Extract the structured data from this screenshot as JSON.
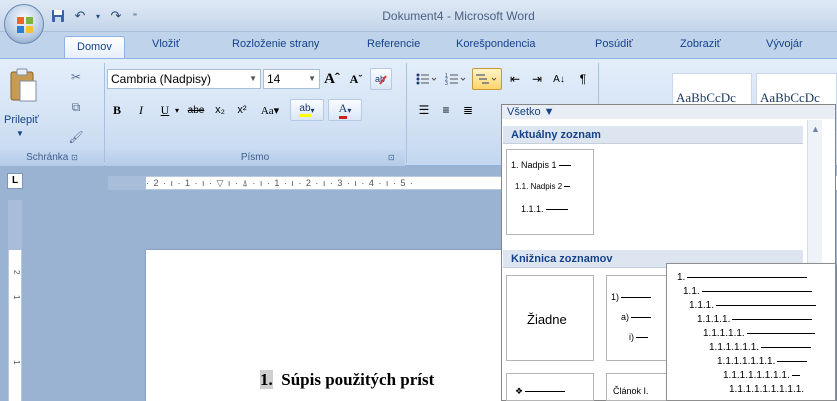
{
  "window": {
    "title_doc": "Dokument4",
    "title_app": "Microsoft Word",
    "separator": " - "
  },
  "tabs": [
    "Domov",
    "Vložiť",
    "Rozloženie strany",
    "Referencie",
    "Korešpondencia",
    "Posúdiť",
    "Zobraziť",
    "Vývojár"
  ],
  "clipboard": {
    "paste_label": "Prilepiť",
    "group_label": "Schránka"
  },
  "font": {
    "name": "Cambria (Nadpisy)",
    "size": "14",
    "group_label": "Písmo"
  },
  "styles": [
    "AaBbCcDc",
    "AaBbCcDc"
  ],
  "ruler": {
    "corner": "L",
    "text": "· 2 · ı · 1 · ı ·  ▽ ı · ⍋ · ı · 1 · ı · 2 · ı · 3 · ı · 4 · ı · 5 ·",
    "right_mark": "· 1",
    "vticks": [
      "2",
      "1",
      "1"
    ]
  },
  "document": {
    "heading_number": "1.",
    "heading_text": "Súpis použitých príst"
  },
  "list_panel": {
    "filter": "Všetko ▼",
    "current_section": "Aktuálny zoznam",
    "library_section": "Knižnica zoznamov",
    "current_lines": [
      "1. Nadpis 1",
      "1.1. Nadpis 2",
      "1.1.1."
    ],
    "none_label": "Žiadne",
    "lib_lines": [
      "1)",
      "a)",
      "i)"
    ],
    "bullet_symbol": "❖",
    "article_label": "Článok I."
  },
  "flyout": {
    "lines": [
      "1.",
      "1.1.",
      "1.1.1.",
      "1.1.1.1.",
      "1.1.1.1.1.",
      "1.1.1.1.1.1.",
      "1.1.1.1.1.1.1.",
      "1.1.1.1.1.1.1.1.",
      "1.1.1.1.1.1.1.1.1."
    ]
  }
}
